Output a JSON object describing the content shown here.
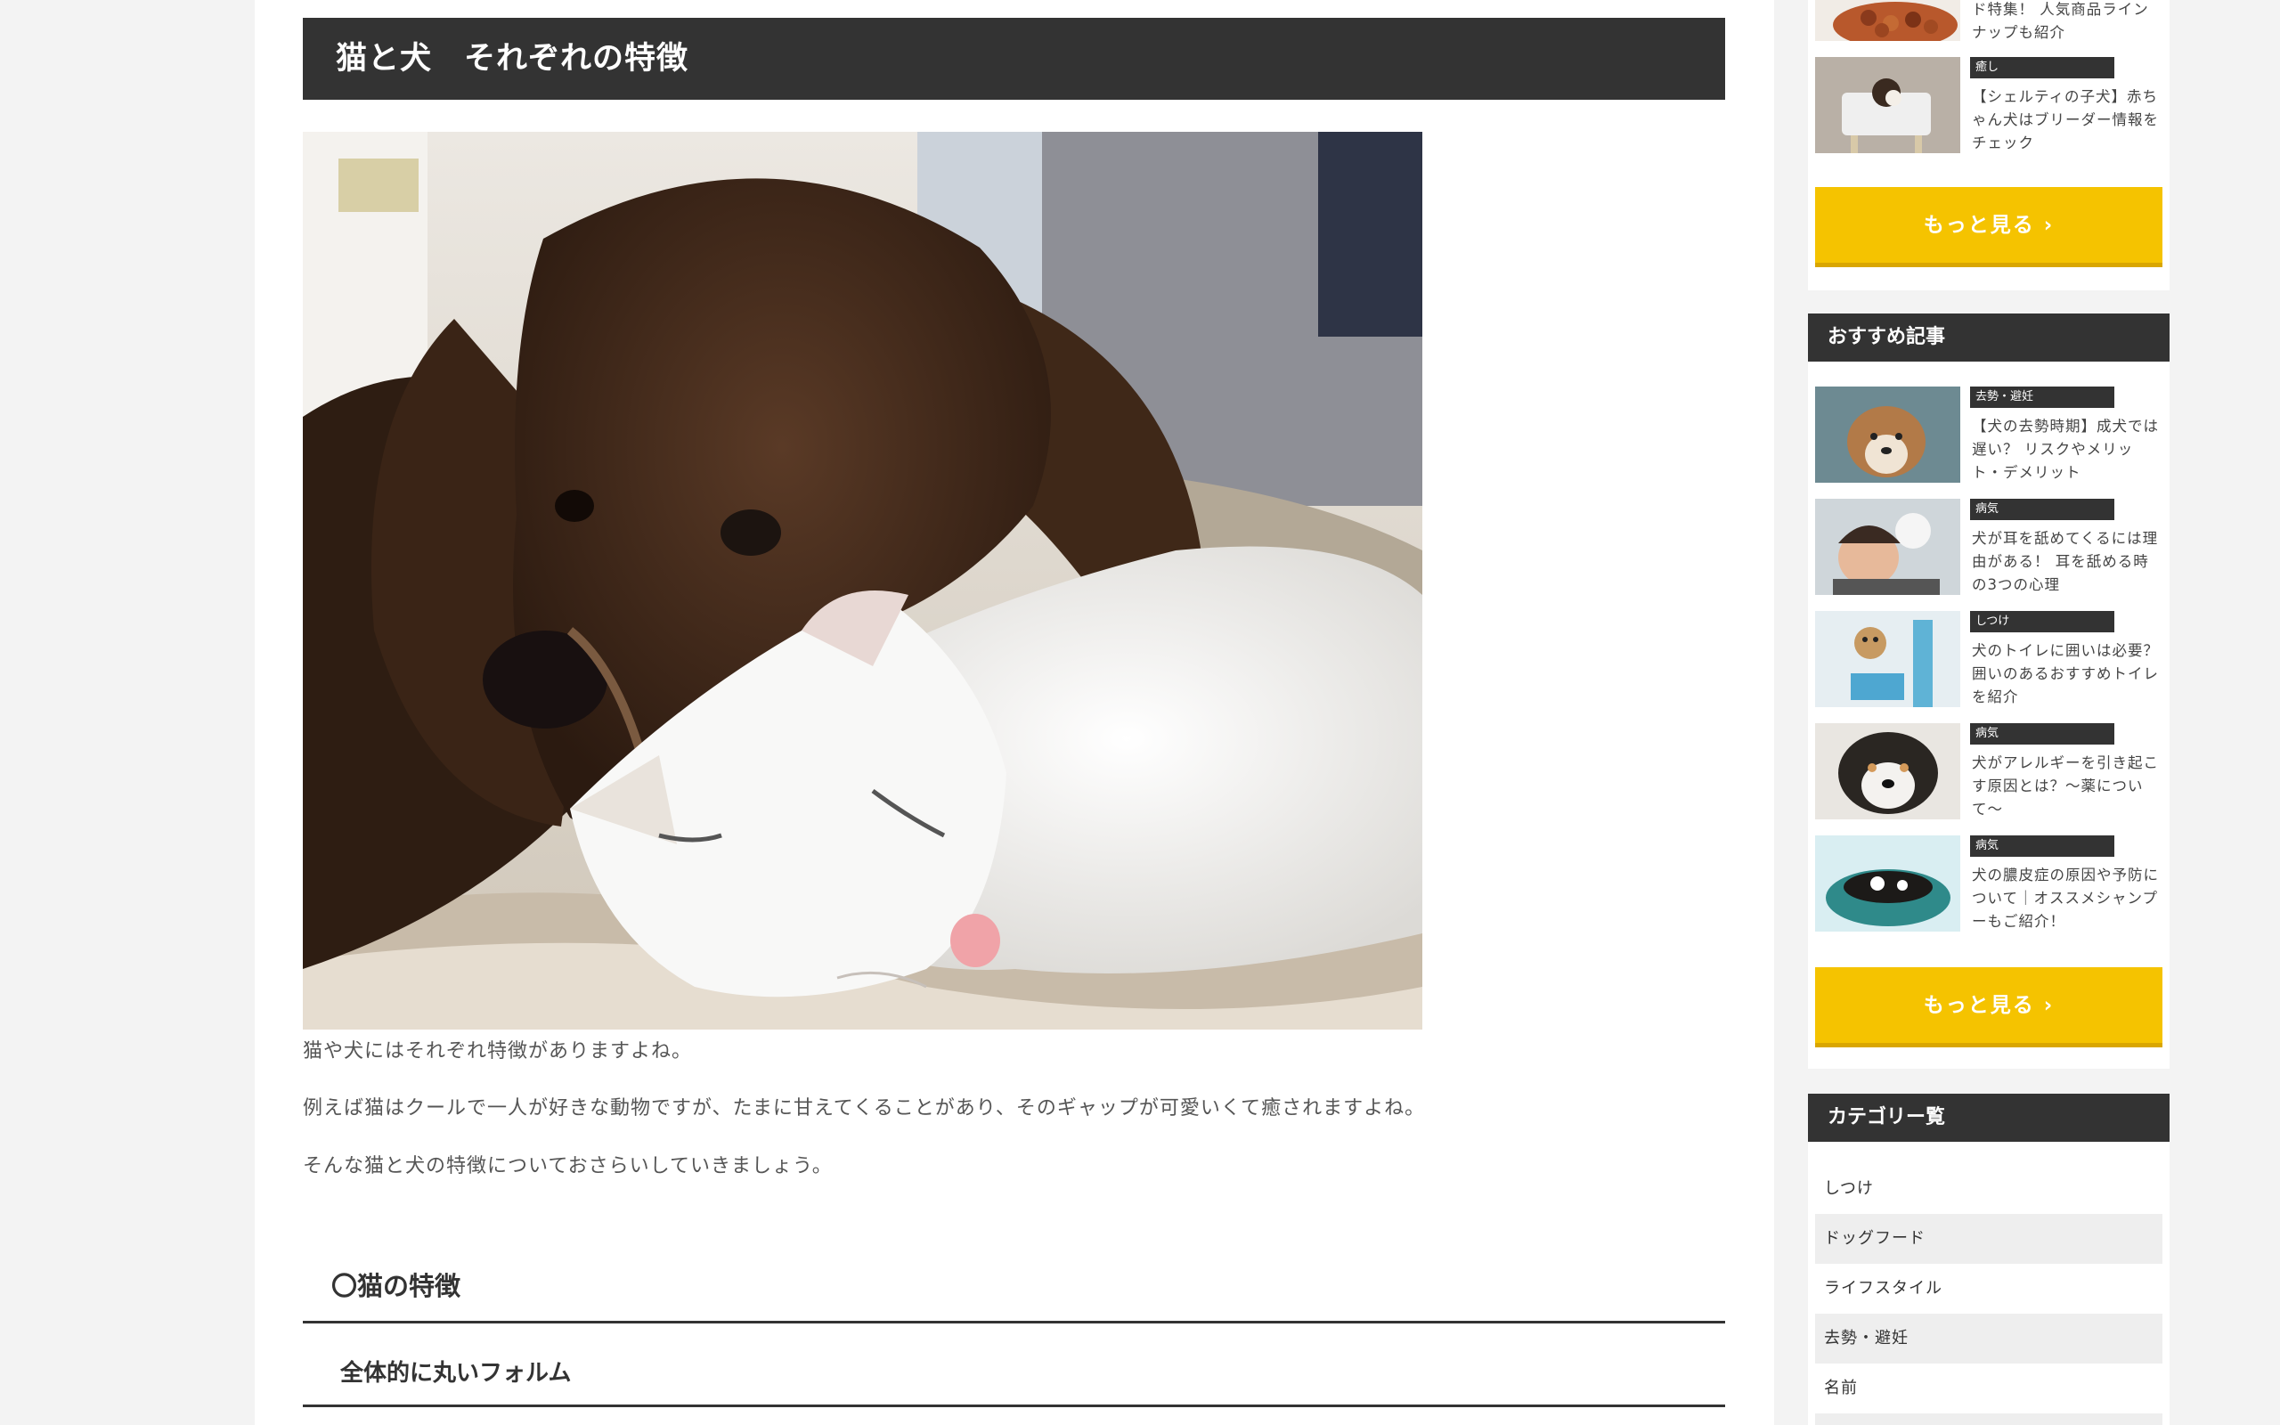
{
  "article": {
    "heading": "猫と犬　それぞれの特徴",
    "paragraphs": [
      "猫や犬にはそれぞれ特徴がありますよね。",
      "例えば猫はクールで一人が好きな動物ですが、たまに甘えてくることがあり、そのギャップが可愛いくて癒されますよね。",
      "そんな猫と犬の特徴についておさらいしていきましょう。"
    ],
    "section_heading": "〇猫の特徴",
    "sub_heading": "全体的に丸いフォルム"
  },
  "sidebar": {
    "top_posts": [
      {
        "title_lines": [
          "ド特集！ 人気商品ライン",
          "ナップも紹介"
        ]
      },
      {
        "badge": "癒し",
        "title_lines": [
          "【シェルティの子犬】赤ち",
          "ゃん犬はブリーダー情報を",
          "チェック"
        ]
      }
    ],
    "more_label": "もっと見る ›",
    "recommended": {
      "heading": "おすすめ記事",
      "posts": [
        {
          "badge": "去勢・避妊",
          "title_lines": [
            "【犬の去勢時期】成犬では",
            "遅い？ リスクやメリッ",
            "ト・デメリット"
          ]
        },
        {
          "badge": "病気",
          "title_lines": [
            "犬が耳を舐めてくるには理",
            "由がある！ 耳を舐める時",
            "の3つの心理"
          ]
        },
        {
          "badge": "しつけ",
          "title_lines": [
            "犬のトイレに囲いは必要？",
            "囲いのあるおすすめトイレ",
            "を紹介"
          ]
        },
        {
          "badge": "病気",
          "title_lines": [
            "犬がアレルギーを引き起こ",
            "す原因とは？～薬につい",
            "て～"
          ]
        },
        {
          "badge": "病気",
          "title_lines": [
            "犬の膿皮症の原因や予防に",
            "ついて｜オススメシャンプ",
            "ーもご紹介！"
          ]
        }
      ]
    },
    "categories": {
      "heading": "カテゴリー覧",
      "items": [
        "しつけ",
        "ドッグフード",
        "ライフスタイル",
        "去勢・避妊",
        "名前"
      ]
    }
  },
  "colors": {
    "accent": "#f5c300",
    "dark": "#333333",
    "text": "#555555",
    "stripe": "#eeeeee"
  }
}
